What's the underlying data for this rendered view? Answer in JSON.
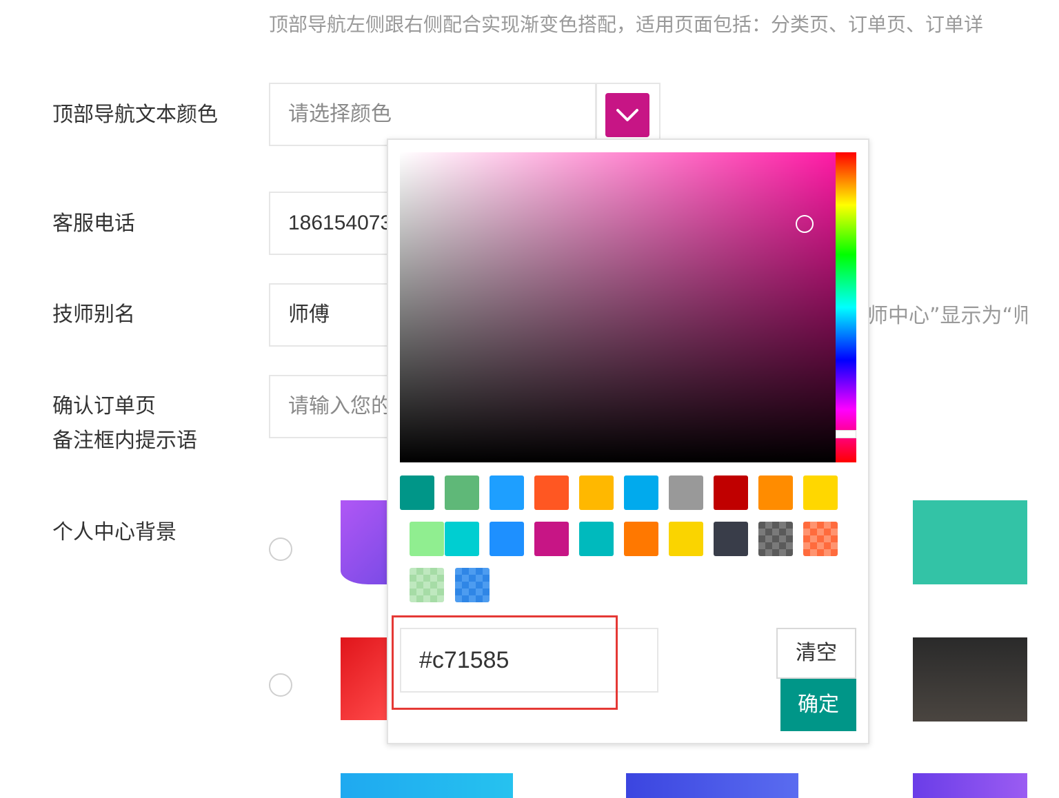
{
  "hint_text": "顶部导航左侧跟右侧配合实现渐变色搭配，适用页面包括：分类页、订单页、订单详",
  "fields": {
    "nav_text_color": {
      "label": "顶部导航文本颜色",
      "placeholder": "请选择颜色"
    },
    "service_phone": {
      "label": "客服电话",
      "value": "186154073"
    },
    "technician_alias": {
      "label": "技师别名",
      "value": "师傅",
      "note": "师中心”显示为“师傅"
    },
    "order_note_hint": {
      "label_line1": "确认订单页",
      "label_line2": "备注框内提示语",
      "placeholder": "请输入您的"
    },
    "profile_bg": {
      "label": "个人中心背景"
    }
  },
  "color_picker": {
    "current_color": "#c71585",
    "hex_value": "#c71585",
    "clear_label": "清空",
    "confirm_label": "确定",
    "confirm_color": "#009688",
    "swatches_row1": [
      "#009688",
      "#5fb878",
      "#1e9fff",
      "#ff5722",
      "#ffb800",
      "#01aaed",
      "#999999",
      "#c00000",
      "#ff8c00",
      "#ffd700"
    ],
    "swatches_row2": [
      "#90ee90",
      "#00ced1",
      "#1e90ff",
      "#c71585",
      "#00babd",
      "#ff7800",
      "#fad400",
      "#393d49",
      "checker-dark",
      "checker-orange"
    ],
    "swatches_row3": [
      "checker-green",
      "checker-blue"
    ]
  },
  "icons": {
    "dropdown": "chevron-down-icon"
  }
}
